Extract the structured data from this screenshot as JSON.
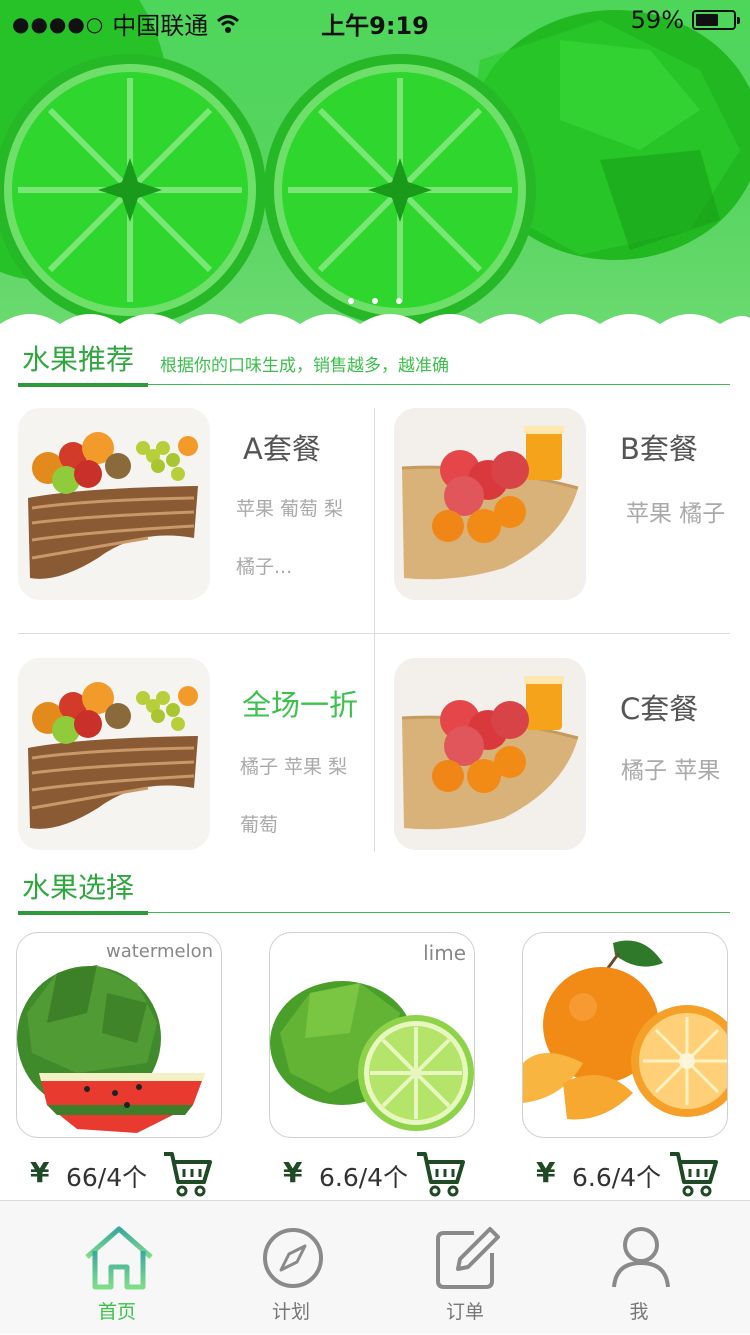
{
  "status_bar": {
    "signal": "●●●●○",
    "carrier": "中国联通",
    "time": "上午9:19",
    "battery": "59%",
    "battery_level": 0.59
  },
  "banner": {
    "slide_count": 3,
    "colors": {
      "background": "#57d460",
      "lime": "#2ecc2e",
      "lime_dark": "#1fa01f"
    }
  },
  "recommend": {
    "title": "水果推荐",
    "subtitle": "根据你的口味生成，销售越多，越准确",
    "items": [
      {
        "name": "A套餐",
        "desc": "苹果 葡萄 梨 橘子...",
        "highlight": false
      },
      {
        "name": "B套餐",
        "desc": "苹果 橘子",
        "highlight": false
      },
      {
        "name": "全场一折",
        "desc": "橘子 苹果 梨 葡萄",
        "highlight": true
      },
      {
        "name": "C套餐",
        "desc": "橘子 苹果",
        "highlight": false
      }
    ]
  },
  "select": {
    "title": "水果选择",
    "items": [
      {
        "tag": "watermelon",
        "currency": "¥",
        "price": "66/4个",
        "cart_icon": "cart-icon"
      },
      {
        "tag": "lime",
        "currency": "¥",
        "price": "6.6/4个",
        "cart_icon": "cart-icon"
      },
      {
        "tag": "",
        "currency": "¥",
        "price": "6.6/4个",
        "cart_icon": "cart-icon"
      }
    ]
  },
  "tabbar": {
    "items": [
      {
        "label": "首页",
        "icon": "home-icon",
        "active": true
      },
      {
        "label": "计划",
        "icon": "compass-icon",
        "active": false
      },
      {
        "label": "订单",
        "icon": "edit-icon",
        "active": false
      },
      {
        "label": "我",
        "icon": "user-icon",
        "active": false
      }
    ]
  },
  "colors": {
    "accent": "#3cc24c",
    "accent_dark": "#2f9a3c",
    "text_gray": "#aaaaaa"
  }
}
